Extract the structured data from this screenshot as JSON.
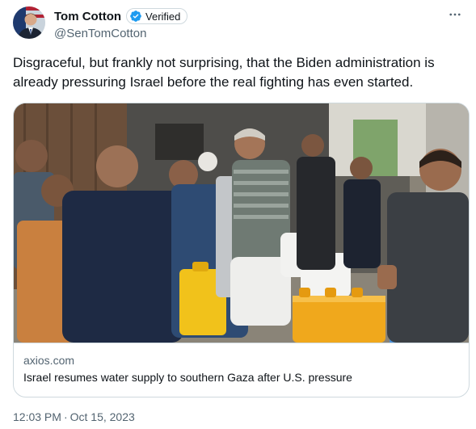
{
  "author": {
    "display_name": "Tom Cotton",
    "handle": "@SenTomCotton",
    "verified_label": "Verified",
    "verified_icon": "blue-check-badge-icon",
    "avatar": "profile-photo-with-flag"
  },
  "more_icon": "more-horizontal-icon",
  "tweet": {
    "text": "Disgraceful, but frankly not surprising, that the Biden administration is already pressuring Israel before the real fighting has even started."
  },
  "card": {
    "image": "crowd-filling-water-jerrycans-photo",
    "domain": "axios.com",
    "title": "Israel resumes water supply to southern Gaza after U.S. pressure"
  },
  "timestamp": {
    "time": "12:03 PM",
    "separator": "·",
    "date": "Oct 15, 2023"
  },
  "colors": {
    "text_primary": "#0f1419",
    "text_secondary": "#536471",
    "border": "#cfd9de",
    "verified_blue": "#1d9bf0"
  }
}
